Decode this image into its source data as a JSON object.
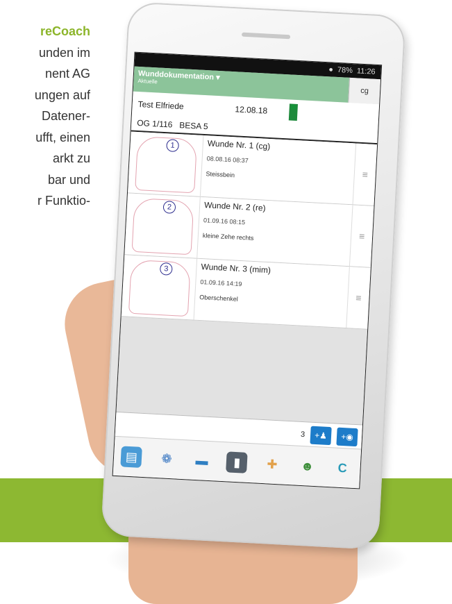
{
  "left_text": {
    "lines": [
      "reCoach",
      "unden im",
      "nent AG",
      "ungen auf",
      "Datener-",
      "ufft, einen",
      "arkt zu",
      "bar und",
      "r Funktio-"
    ]
  },
  "status": {
    "battery": "78%",
    "time": "11:26"
  },
  "app": {
    "title": "Wunddokumentation",
    "subtitle": "Aktuelle",
    "user": "cg"
  },
  "patient": {
    "name": "Test Elfriede",
    "date": "12.08.18",
    "flag": "D",
    "room": "OG 1/116",
    "besa": "BESA 5"
  },
  "wounds": [
    {
      "number": "1",
      "title": "Wunde Nr. 1 (cg)",
      "date": "08.08.16 08:37",
      "location": "Steissbein"
    },
    {
      "number": "2",
      "title": "Wunde Nr. 2 (re)",
      "date": "01.09.16 08:15",
      "location": "kleine Zehe rechts"
    },
    {
      "number": "3",
      "title": "Wunde Nr. 3 (mim)",
      "date": "01.09.16 14:19",
      "location": "Oberschenkel"
    }
  ],
  "bottom": {
    "count": "3",
    "add_wound_label": "+",
    "add_photo_label": "+"
  },
  "nav_icons": [
    "id-card-icon",
    "stethoscope-icon",
    "bed-icon",
    "book-icon",
    "bandage-icon",
    "users-icon",
    "carecoach-logo-icon"
  ],
  "colors": {
    "brand_green": "#8db832",
    "appbar_green": "#8cc49a",
    "button_blue": "#1d7cc9"
  }
}
